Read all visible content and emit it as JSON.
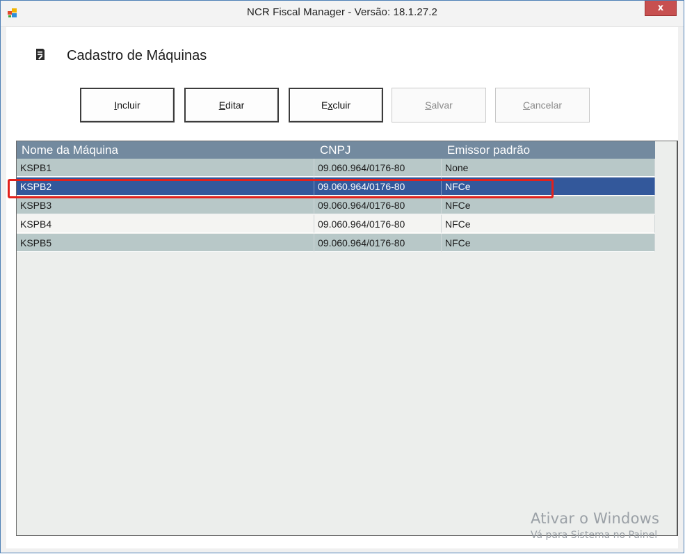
{
  "window": {
    "title": "NCR Fiscal Manager - Versão: 18.1.27.2",
    "close_label": "x"
  },
  "header": {
    "title": "Cadastro de Máquinas"
  },
  "toolbar": {
    "include": {
      "label": "Incluir",
      "mnemonic": "I",
      "rest": "ncluir",
      "enabled": true
    },
    "edit": {
      "label": "Editar",
      "mnemonic": "E",
      "rest": "ditar",
      "enabled": true
    },
    "delete": {
      "label": "Excluir",
      "mnemonic": "x",
      "pre": "E",
      "rest": "cluir",
      "enabled": true
    },
    "save": {
      "label": "Salvar",
      "mnemonic": "S",
      "rest": "alvar",
      "enabled": false
    },
    "cancel": {
      "label": "Cancelar",
      "mnemonic": "C",
      "rest": "ancelar",
      "enabled": false
    }
  },
  "grid": {
    "columns": [
      "Nome da Máquina",
      "CNPJ",
      "Emissor padrão"
    ],
    "rows": [
      {
        "name": "KSPB1",
        "cnpj": "09.060.964/0176-80",
        "emissor": "None"
      },
      {
        "name": "KSPB2",
        "cnpj": "09.060.964/0176-80",
        "emissor": "NFCe"
      },
      {
        "name": "KSPB3",
        "cnpj": "09.060.964/0176-80",
        "emissor": "NFCe"
      },
      {
        "name": "KSPB4",
        "cnpj": "09.060.964/0176-80",
        "emissor": "NFCe"
      },
      {
        "name": "KSPB5",
        "cnpj": "09.060.964/0176-80",
        "emissor": "NFCe"
      }
    ],
    "selected_row": "KSPB2"
  },
  "watermark": {
    "line1": "Ativar o Windows",
    "line2": "Vá para Sistema no Painel"
  },
  "colors": {
    "header_bg": "#738a9f",
    "selected_bg": "#33589b",
    "alt_row_bg": "#b8c8c8",
    "highlight_outline": "#e2211c",
    "close_button_bg": "#c75050"
  },
  "icons": {
    "app": "app-window-icon",
    "header": "document-edit-icon",
    "close": "close-icon"
  }
}
